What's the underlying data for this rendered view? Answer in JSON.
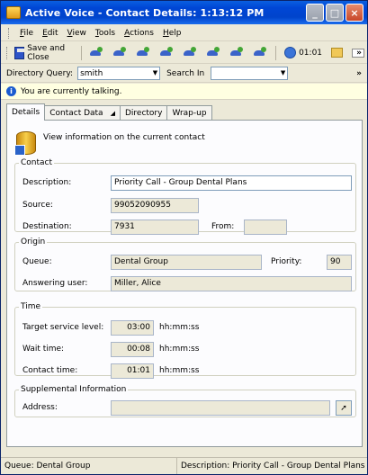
{
  "window": {
    "title": "Active Voice - Contact Details: 1:13:12 PM",
    "buttons": {
      "minimize": "_",
      "maximize": "□",
      "close": "×"
    }
  },
  "menu": {
    "items": [
      {
        "key": "F",
        "rest": "ile"
      },
      {
        "key": "E",
        "rest": "dit"
      },
      {
        "key": "V",
        "rest": "iew"
      },
      {
        "key": "T",
        "rest": "ools"
      },
      {
        "key": "A",
        "rest": "ctions"
      },
      {
        "key": "H",
        "rest": "elp"
      }
    ]
  },
  "toolbar": {
    "save_label": "Save and Close",
    "timer": "01:01",
    "overflow": "»"
  },
  "query": {
    "label": "Directory Query:",
    "value": "smith",
    "search_in_label": "Search In",
    "search_in_value": "",
    "overflow": "»"
  },
  "info": {
    "message": "You are currently talking."
  },
  "tabs": [
    {
      "label": "Details"
    },
    {
      "label": "Contact Data"
    },
    {
      "label": "Directory"
    },
    {
      "label": "Wrap-up"
    }
  ],
  "details": {
    "intro": "View information on the current contact",
    "contact": {
      "legend": "Contact",
      "description_label": "Description:",
      "description": "Priority Call - Group Dental Plans",
      "source_label": "Source:",
      "source": "99052090955",
      "destination_label": "Destination:",
      "destination": "7931",
      "from_label": "From:",
      "from": ""
    },
    "origin": {
      "legend": "Origin",
      "queue_label": "Queue:",
      "queue": "Dental Group",
      "priority_label": "Priority:",
      "priority": "90",
      "answering_label": "Answering user:",
      "answering": "Miller, Alice"
    },
    "time": {
      "legend": "Time",
      "target_label": "Target service level:",
      "target": "03:00",
      "wait_label": "Wait time:",
      "wait": "00:08",
      "contact_label": "Contact time:",
      "contact": "01:01",
      "unit": "hh:mm:ss"
    },
    "supplemental": {
      "legend": "Supplemental Information",
      "address_label": "Address:",
      "address": ""
    }
  },
  "status": {
    "queue": "Queue: Dental Group",
    "description": "Description: Priority Call - Group Dental Plans"
  }
}
